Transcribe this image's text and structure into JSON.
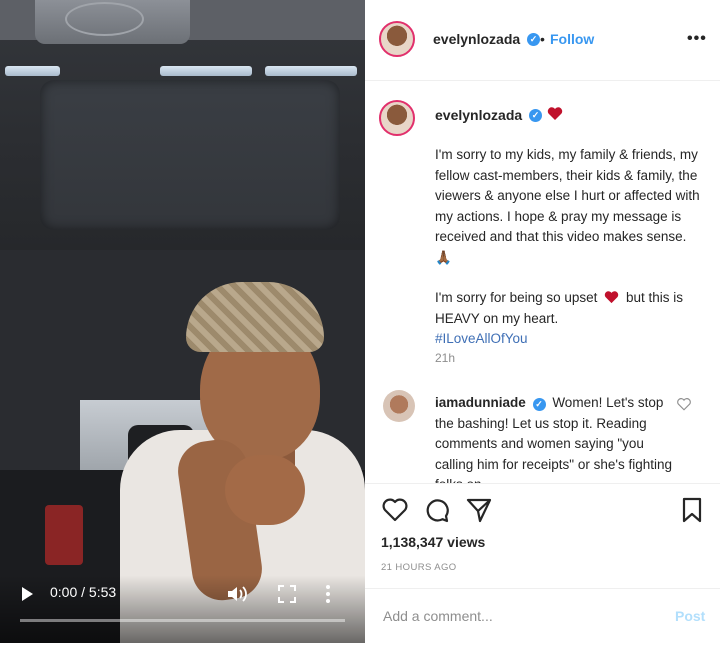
{
  "video": {
    "time_display": "0:00 / 5:53",
    "progress": 0
  },
  "header": {
    "username": "evelynlozada",
    "separator": "•",
    "follow_label": "Follow",
    "more_label": "•••"
  },
  "caption": {
    "username": "evelynlozada",
    "paragraph1": "I'm sorry to my kids, my family & friends, my fellow cast-members, their kids & family, the viewers & anyone else I hurt or affected with my actions. I hope & pray my message is received and that this video makes sense. 🙏🏾",
    "paragraph2_a": "I'm sorry for being so upset",
    "paragraph2_b": "but this is HEAVY on my heart.",
    "hashtag": "#ILoveAllOfYou",
    "time_ago": "21h"
  },
  "comment": {
    "username": "iamadunniade",
    "text": "Women! Let's stop the bashing! Let us stop it. Reading comments and women saying \"you calling him for receipts\" or she's fighting folks on"
  },
  "stats": {
    "views": "1,138,347 views",
    "posted": "21 HOURS AGO"
  },
  "add_comment": {
    "placeholder": "Add a comment...",
    "post_label": "Post"
  },
  "colors": {
    "accent_blue": "#3897f0",
    "heart_red": "#c0112c",
    "post_disabled": "#b2dffc"
  },
  "icons": [
    "play-icon",
    "volume-icon",
    "fullscreen-icon",
    "more-vertical-icon",
    "verified-icon",
    "heart-icon",
    "comment-icon",
    "share-icon",
    "bookmark-icon",
    "more-horizontal-icon"
  ]
}
